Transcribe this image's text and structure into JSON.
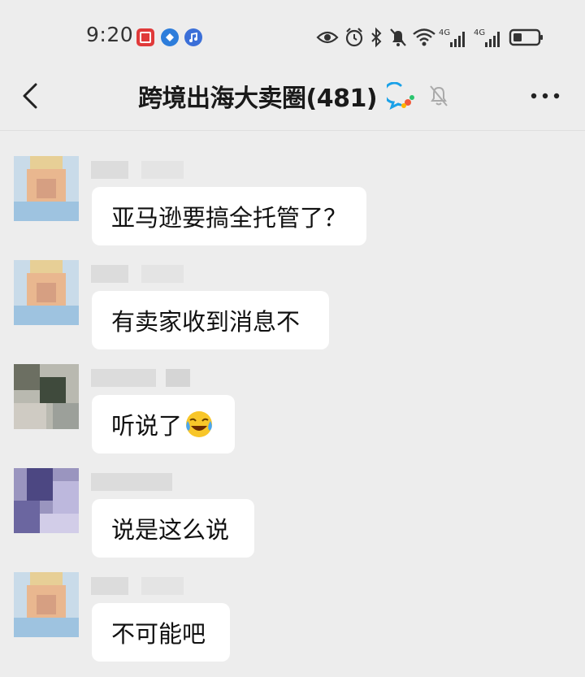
{
  "status_bar": {
    "time": "9:20",
    "icons": [
      "notification-app-icon",
      "browser-app-icon",
      "music-app-icon",
      "eye-icon",
      "alarm-icon",
      "bluetooth-icon",
      "mute-icon",
      "wifi-icon",
      "signal-4g-icon",
      "signal-4g-icon",
      "battery-icon"
    ],
    "network_label_1": "4G",
    "network_label_2": "4G"
  },
  "header": {
    "title": "跨境出海大卖圈(481)",
    "back_icon": "chevron-left-icon",
    "group_icon": "chat-bubble-icon",
    "mute_icon": "bell-off-icon",
    "more_icon": "more-horizontal-icon"
  },
  "messages": [
    {
      "text": "亚马逊要搞全托管了？"
    },
    {
      "text": "有卖家收到消息不"
    },
    {
      "text": "听说了",
      "emoji": "crying-laughing-emoji"
    },
    {
      "text": "说是这么说"
    },
    {
      "text": "不可能吧"
    }
  ],
  "colors": {
    "background": "#ededed",
    "bubble": "#ffffff",
    "text": "#111111"
  }
}
